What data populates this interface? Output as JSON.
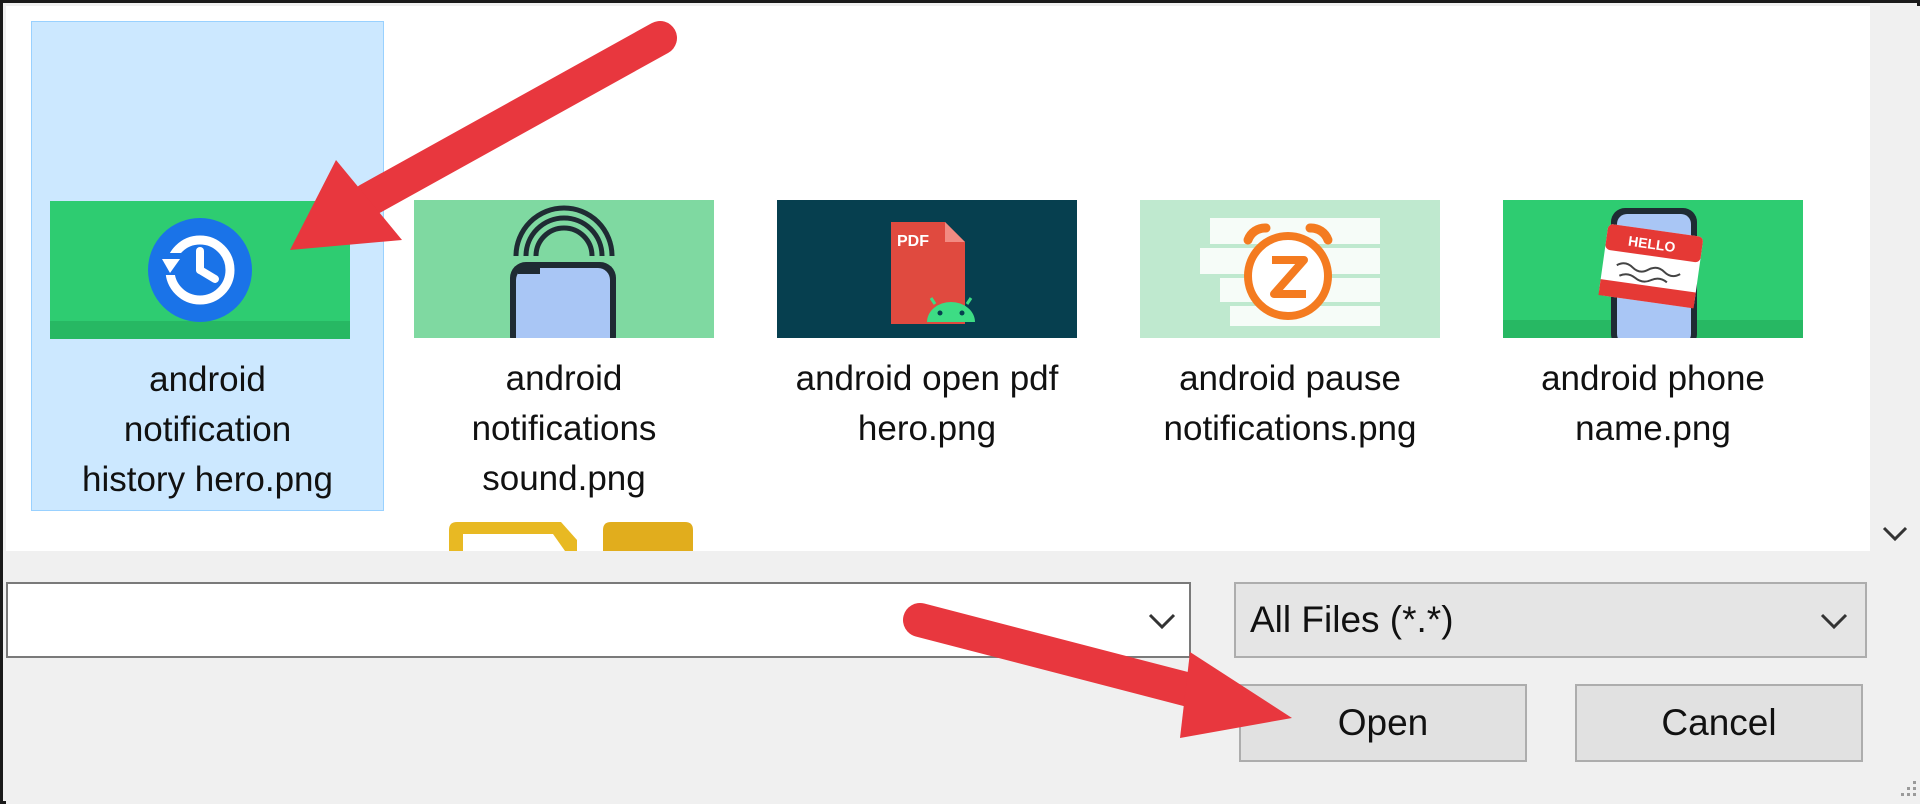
{
  "files": [
    {
      "name": "android notification history hero.png",
      "lines": [
        "android",
        "notification",
        "history hero.png"
      ],
      "selected": true
    },
    {
      "name": "android notifications sound.png",
      "lines": [
        "android",
        "notifications",
        "sound.png"
      ],
      "selected": false
    },
    {
      "name": "android open pdf hero.png",
      "lines": [
        "android open pdf",
        "hero.png"
      ],
      "selected": false
    },
    {
      "name": "android pause notifications.png",
      "lines": [
        "android pause",
        "notifications.png"
      ],
      "selected": false
    },
    {
      "name": "android phone name.png",
      "lines": [
        "android phone",
        "name.png"
      ],
      "selected": false
    }
  ],
  "thumbnail_text": {
    "pdf": "PDF",
    "hello_tag": "HELLO"
  },
  "filename_field": {
    "value": ""
  },
  "filetype": {
    "selected": "All Files (*.*)"
  },
  "buttons": {
    "open": "Open",
    "cancel": "Cancel"
  },
  "icons": {
    "scroll": "chevron-down-icon",
    "combo": "chevron-down-icon",
    "grip": "resize-grip-icon",
    "annotation": "red-arrow-icon"
  },
  "colors": {
    "selection": "#cce8ff",
    "selection_border": "#99d1ff",
    "annotation_arrow": "#e8373e",
    "green_thumb": "#2ecc71",
    "teal_thumb": "#063f4f"
  }
}
